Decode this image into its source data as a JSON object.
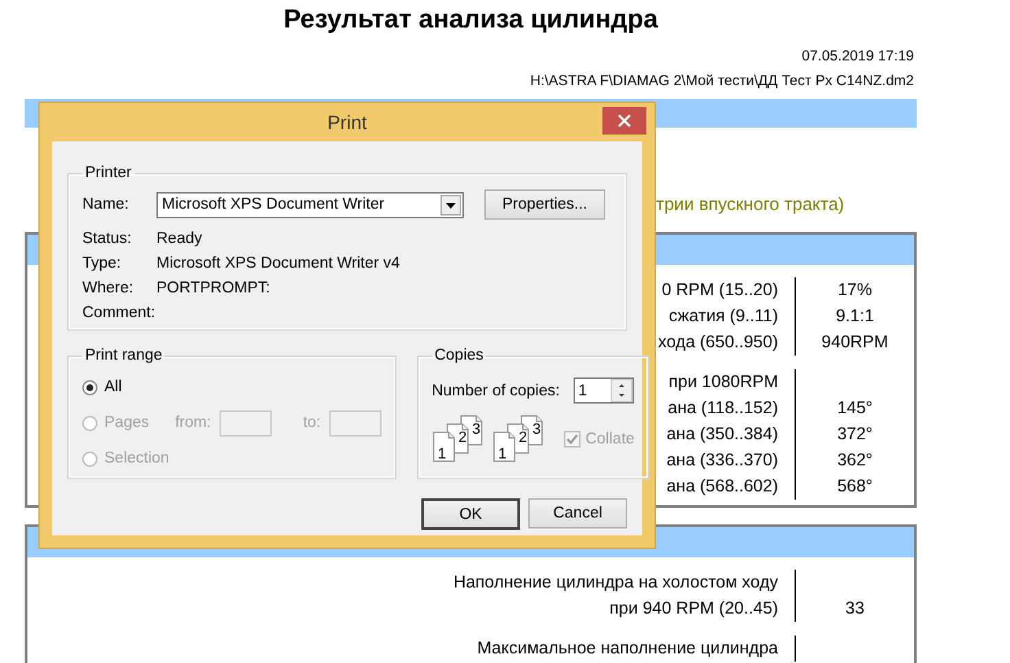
{
  "report": {
    "title": "Результат анализа цилиндра",
    "date": "07.05.2019 17:19",
    "file_path": "H:\\ASTRA F\\DIAMAG 2\\Мой тести\\ДД Тест Px C14NZ.dm2",
    "sections": [
      {
        "kind": "band"
      },
      {
        "kind": "note",
        "text": "трии впускного тракта)"
      },
      {
        "kind": "table",
        "groups": [
          [
            {
              "lines": [
                "0 RPM (15..20)"
              ],
              "value": "17%"
            },
            {
              "lines": [
                "сжатия (9..11)"
              ],
              "value": "9.1:1"
            },
            {
              "lines": [
                "хода (650..950)"
              ],
              "value": "940RPM"
            }
          ],
          [
            {
              "lines": [
                "при 1080RPM"
              ]
            },
            {
              "lines": [
                "ана (118..152)"
              ],
              "value": "145°"
            },
            {
              "lines": [
                "ана (350..384)"
              ],
              "value": "372°"
            },
            {
              "lines": [
                "ана (336..370)"
              ],
              "value": "362°"
            },
            {
              "lines": [
                "ана (568..602)"
              ],
              "value": "568°"
            }
          ]
        ]
      },
      {
        "kind": "table",
        "groups": [
          [
            {
              "lines": [
                "Наполнение цилиндра на холостом ходу",
                "при 940 RPM (20..45)"
              ],
              "value": "33"
            }
          ],
          [
            {
              "lines": [
                "Максимальное наполнение цилиндра"
              ]
            }
          ]
        ]
      }
    ]
  },
  "dialog": {
    "title": "Print",
    "printer": {
      "legend": "Printer",
      "name_label": "Name:",
      "name_value": "Microsoft XPS Document Writer",
      "properties_button": "Properties...",
      "info": [
        {
          "label": "Status:",
          "value": "Ready"
        },
        {
          "label": "Type:",
          "value": "Microsoft XPS Document Writer v4"
        },
        {
          "label": "Where:",
          "value": "PORTPROMPT:"
        },
        {
          "label": "Comment:"
        }
      ]
    },
    "print_range": {
      "legend": "Print range",
      "options": [
        {
          "label": "All",
          "selected": true,
          "disabled": false
        },
        {
          "label": "Pages",
          "selected": false,
          "disabled": true
        },
        {
          "label": "Selection",
          "selected": false,
          "disabled": true
        }
      ],
      "from_label": "from:",
      "to_label": "to:"
    },
    "copies": {
      "legend": "Copies",
      "number_label": "Number of copies:",
      "number_value": "1",
      "page_stacks": [
        [
          "1",
          "2",
          "3"
        ],
        [
          "1",
          "2",
          "3"
        ]
      ],
      "collate": {
        "label": "Collate",
        "checked": true,
        "disabled": true
      }
    },
    "buttons": [
      {
        "label": "OK",
        "default": true
      },
      {
        "label": "Cancel",
        "default": false
      }
    ]
  }
}
